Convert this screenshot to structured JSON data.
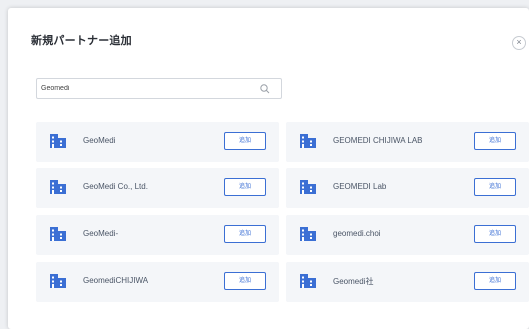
{
  "dialog": {
    "title": "新規パートナー追加",
    "close_label": "×"
  },
  "search": {
    "value": "Geomedi",
    "placeholder": ""
  },
  "results": [
    {
      "name": "GeoMedi",
      "add_label": "追加"
    },
    {
      "name": "GEOMEDI CHIJIWA LAB",
      "add_label": "追加"
    },
    {
      "name": "GeoMedi Co., Ltd.",
      "add_label": "追加"
    },
    {
      "name": "GEOMEDI Lab",
      "add_label": "追加"
    },
    {
      "name": "GeoMedi-",
      "add_label": "追加"
    },
    {
      "name": "geomedi.choi",
      "add_label": "追加"
    },
    {
      "name": "GeomediCHIJIWA",
      "add_label": "追加"
    },
    {
      "name": "Geomedi社",
      "add_label": "追加"
    }
  ],
  "colors": {
    "accent": "#3b6fd4",
    "card_bg": "#f4f6f9"
  },
  "icons": {
    "result": "organization-icon",
    "search": "search-icon",
    "close": "close-icon"
  }
}
